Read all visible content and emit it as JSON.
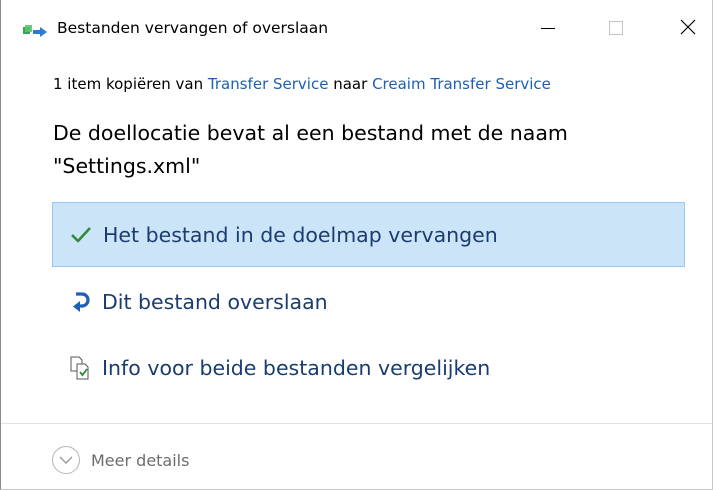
{
  "window": {
    "title": "Bestanden vervangen of overslaan",
    "icon": "file-transfer-icon",
    "controls": {
      "minimize_icon": "minimize-icon",
      "maximize_icon": "maximize-icon",
      "close_icon": "close-icon"
    }
  },
  "source_line": {
    "prefix": "1 item kopiëren van",
    "from_link": "Transfer Service",
    "middle": "naar",
    "to_link": "Creaim Transfer Service"
  },
  "question": {
    "line1": "De doellocatie bevat al een bestand met de naam",
    "line2": "\"Settings.xml\""
  },
  "options": [
    {
      "label": "Het bestand in de doelmap vervangen",
      "icon": "checkmark-icon",
      "selected": true
    },
    {
      "label": "Dit bestand overslaan",
      "icon": "skip-arrow-icon",
      "selected": false
    },
    {
      "label": "Info voor beide bestanden vergelijken",
      "icon": "compare-files-icon",
      "selected": false
    }
  ],
  "details": {
    "label": "Meer details",
    "icon": "chevron-down-circle-icon"
  },
  "colors": {
    "link": "#1e5fb4",
    "option_text": "#1b3c6e",
    "selected_bg": "#cce4f7",
    "selected_border": "#99c9ef",
    "check_green": "#2e8b3a"
  }
}
